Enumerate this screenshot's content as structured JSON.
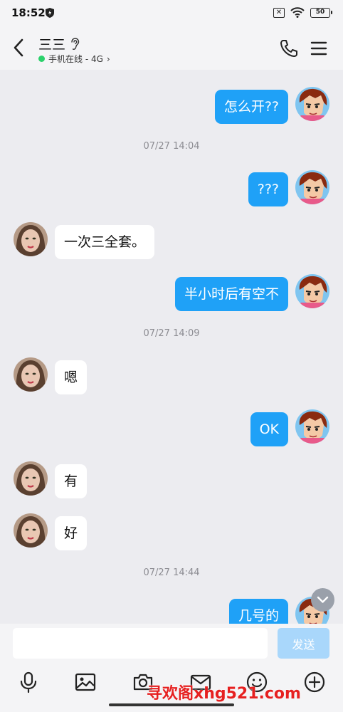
{
  "status_bar": {
    "time": "18:52",
    "battery": "50"
  },
  "header": {
    "title": "三三",
    "status_text": "手机在线 - 4G",
    "chevron": "›"
  },
  "messages": [
    {
      "side": "out",
      "text": "怎么开??"
    },
    {
      "side": "time",
      "text": "07/27 14:04"
    },
    {
      "side": "out",
      "text": "???"
    },
    {
      "side": "in",
      "text": "一次三全套。"
    },
    {
      "side": "out",
      "text": "半小时后有空不"
    },
    {
      "side": "time",
      "text": "07/27 14:09"
    },
    {
      "side": "in",
      "text": "嗯"
    },
    {
      "side": "out",
      "text": "OK"
    },
    {
      "side": "in",
      "text": "有"
    },
    {
      "side": "in",
      "text": "好"
    },
    {
      "side": "time",
      "text": "07/27 14:44"
    },
    {
      "side": "out",
      "text": "几号的"
    }
  ],
  "input": {
    "value": "",
    "placeholder": "",
    "send_label": "发送"
  },
  "toolbar": [
    "mic-icon",
    "image-icon",
    "camera-icon",
    "mail-icon",
    "emoji-icon",
    "plus-icon"
  ],
  "watermark": "寻欢阁xhg521.com",
  "colors": {
    "outgoing_bubble": "#1fa1f7",
    "incoming_bubble": "#ffffff",
    "background": "#ececf0",
    "send_button": "#a9d7fb",
    "online": "#2bd16b"
  }
}
